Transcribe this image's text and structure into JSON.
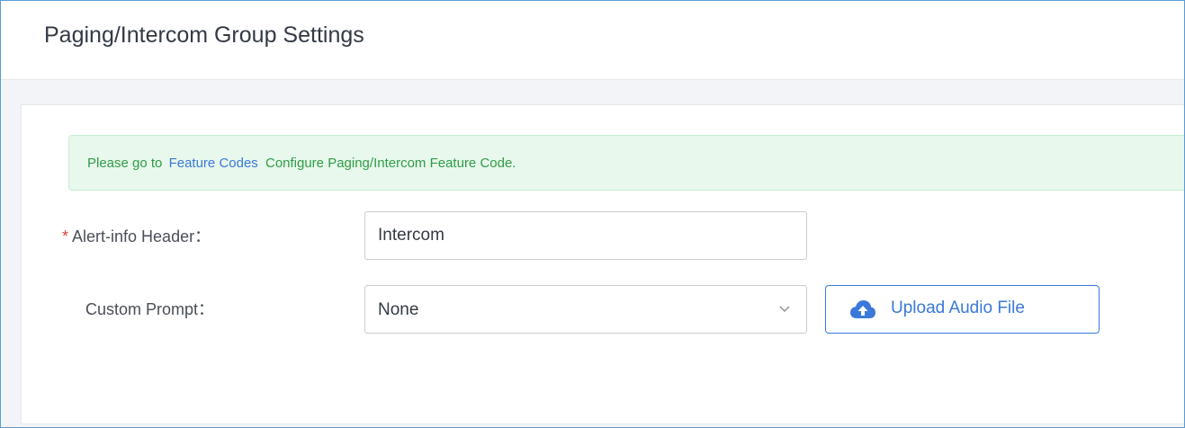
{
  "header": {
    "title": "Paging/Intercom Group Settings"
  },
  "notice": {
    "prefix": "Please go to",
    "link_label": "Feature Codes",
    "suffix": "Configure Paging/Intercom Feature Code."
  },
  "form": {
    "alert_info": {
      "required_marker": "*",
      "label": "Alert-info Header：",
      "value": "Intercom"
    },
    "custom_prompt": {
      "label": "Custom Prompt：",
      "selected": "None"
    },
    "upload_button": {
      "label": "Upload Audio File",
      "icon": "cloud-upload-icon"
    }
  },
  "colors": {
    "accent": "#3a79d9",
    "notice_background": "#e8f8ec",
    "notice_text": "#2f9b46",
    "required": "#e0413a"
  }
}
